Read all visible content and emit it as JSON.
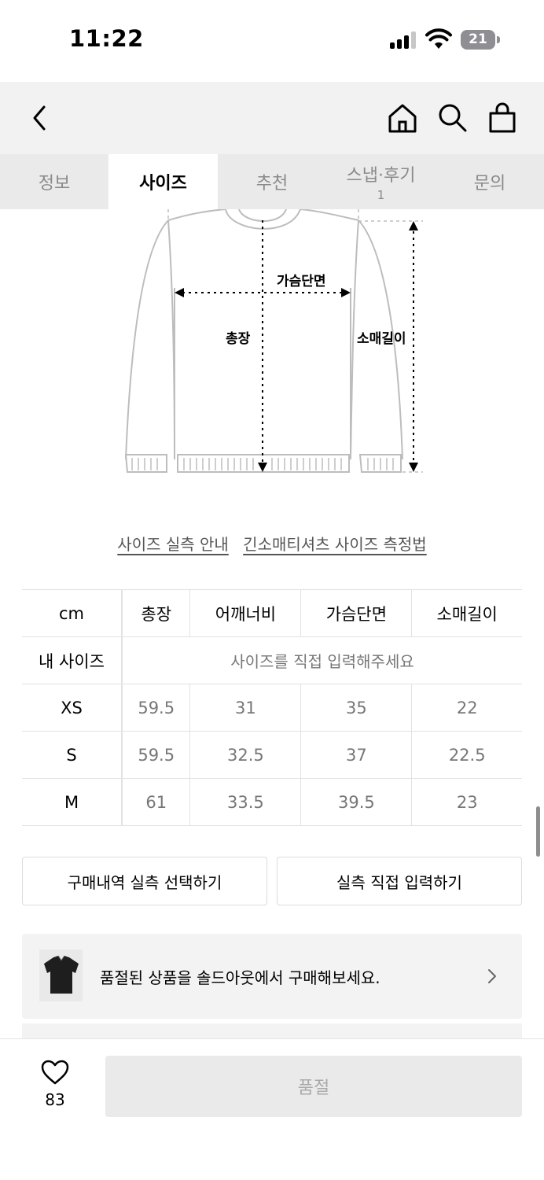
{
  "status_bar": {
    "time": "11:22",
    "battery": "21"
  },
  "tabs": [
    {
      "label": "정보",
      "count": ""
    },
    {
      "label": "사이즈",
      "count": ""
    },
    {
      "label": "추천",
      "count": ""
    },
    {
      "label": "스냅·후기",
      "count": "1"
    },
    {
      "label": "문의",
      "count": ""
    }
  ],
  "active_tab": "사이즈",
  "diagram": {
    "chest_label": "가슴단면",
    "length_label": "총장",
    "sleeve_label": "소매길이"
  },
  "links": {
    "size_guide": "사이즈 실측 안내",
    "measure_method": "긴소매티셔츠 사이즈 측정법"
  },
  "size_table": {
    "columns": [
      "cm",
      "총장",
      "어깨너비",
      "가슴단면",
      "소매길이"
    ],
    "my_size_label": "내 사이즈",
    "my_size_placeholder": "사이즈를 직접 입력해주세요",
    "rows": [
      {
        "size": "XS",
        "values": [
          "59.5",
          "31",
          "35",
          "22"
        ]
      },
      {
        "size": "S",
        "values": [
          "59.5",
          "32.5",
          "37",
          "22.5"
        ]
      },
      {
        "size": "M",
        "values": [
          "61",
          "33.5",
          "39.5",
          "23"
        ]
      }
    ]
  },
  "buttons": {
    "history_select": "구매내역 실측 선택하기",
    "direct_input": "실측 직접 입력하기"
  },
  "soldout_banner": {
    "text": "품절된 상품을 솔드아웃에서 구매해보세요."
  },
  "bottom_bar": {
    "like_count": "83",
    "buy_label": "품절"
  }
}
